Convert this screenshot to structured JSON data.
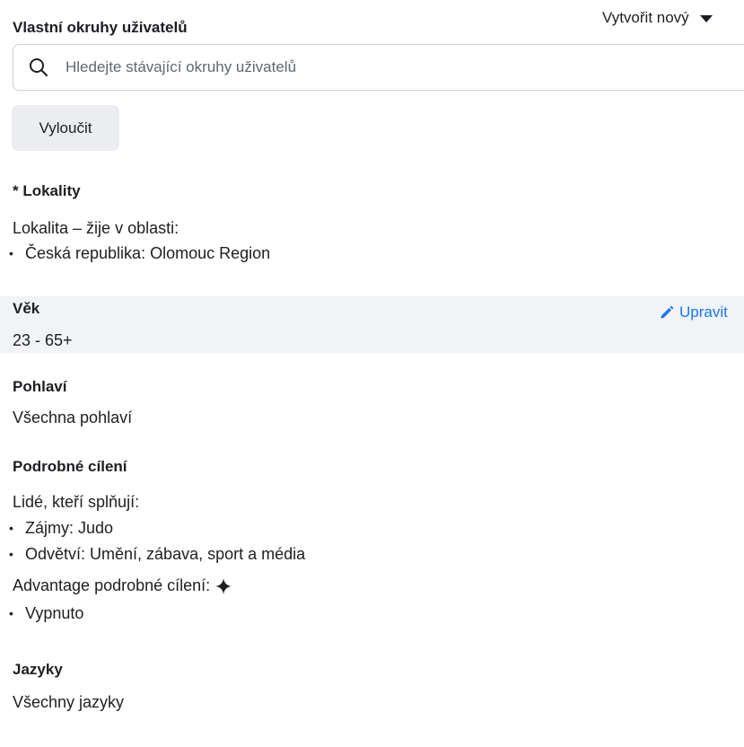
{
  "header": {
    "title": "Vlastní okruhy uživatelů",
    "create_new_label": "Vytvořit nový"
  },
  "search": {
    "placeholder": "Hledejte stávající okruhy uživatelů",
    "value": ""
  },
  "exclude_button": {
    "label": "Vyloučit"
  },
  "locations": {
    "title": "* Lokality",
    "subtitle": "Lokalita – žije v oblasti:",
    "items": [
      "Česká republika: Olomouc Region"
    ]
  },
  "age": {
    "title": "Věk",
    "value": "23 - 65+",
    "edit_label": "Upravit"
  },
  "gender": {
    "title": "Pohlaví",
    "value": "Všechna pohlaví"
  },
  "detailed_targeting": {
    "title": "Podrobné cílení",
    "subtitle": "Lidé, kteří splňují:",
    "items": [
      "Zájmy: Judo",
      "Odvětví: Umění, zábava, sport a média"
    ],
    "advantage_label": "Advantage podrobné cílení:",
    "advantage_items": [
      "Vypnuto"
    ]
  },
  "languages": {
    "title": "Jazyky",
    "value": "Všechny jazyky"
  },
  "colors": {
    "accent": "#1877f2",
    "age_background": "#f2f3f5",
    "button_background": "#ebedf0"
  },
  "icons": {
    "search": "search-icon",
    "caret": "caret-down-icon",
    "edit": "pencil-icon",
    "advantage": "sparkle-icon"
  }
}
